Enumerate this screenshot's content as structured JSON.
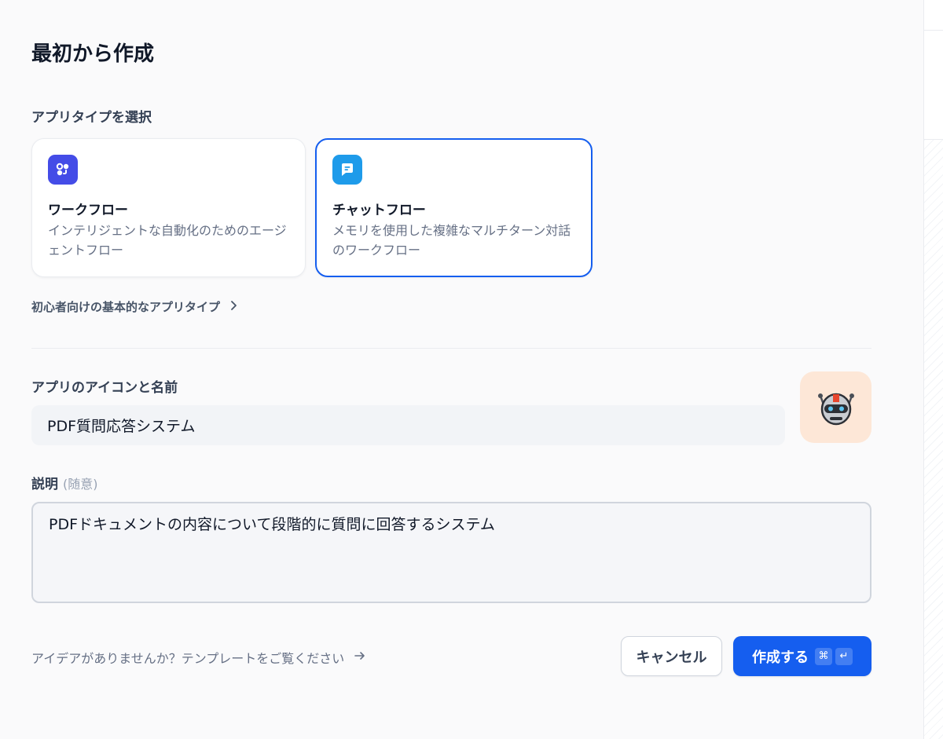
{
  "dialog": {
    "title": "最初から作成"
  },
  "app_type": {
    "label": "アプリタイプを選択",
    "options": [
      {
        "title": "ワークフロー",
        "description": "インテリジェントな自動化のためのエージェントフロー",
        "icon": "workflow-icon",
        "color": "#444ce7"
      },
      {
        "title": "チャットフロー",
        "description": "メモリを使用した複雑なマルチターン対話のワークフロー",
        "icon": "chatflow-icon",
        "color": "#1e9bea",
        "selected": true
      }
    ],
    "beginner_link": "初心者向けの基本的なアプリタイプ"
  },
  "name": {
    "label": "アプリのアイコンと名前",
    "value": "PDF質問応答システム",
    "icon": "robot-icon",
    "icon_bg": "#fde7d7"
  },
  "description": {
    "label": "説明",
    "optional": "(随意)",
    "value": "PDFドキュメントの内容について段階的に質問に回答するシステム"
  },
  "footer": {
    "idea_link": "アイデアがありませんか？テンプレートをご覧ください",
    "cancel_label": "キャンセル",
    "create_label": "作成する",
    "shortcut_cmd": "⌘",
    "shortcut_enter": "↵"
  },
  "colors": {
    "accent": "#155eef"
  }
}
